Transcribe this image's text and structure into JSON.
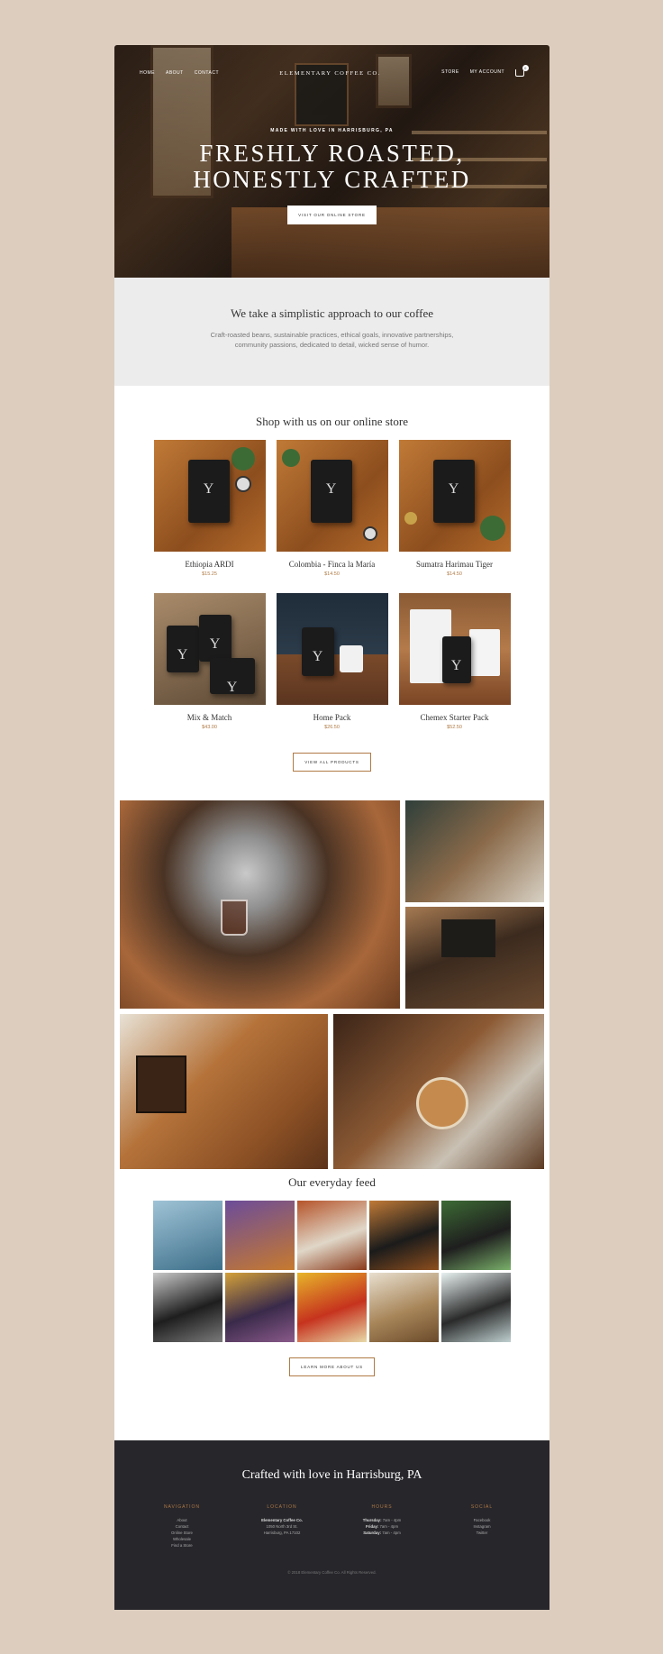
{
  "nav": {
    "left": [
      "Home",
      "About",
      "Contact"
    ],
    "brand": "Elementary Coffee Co.",
    "right": [
      "Store",
      "My Account"
    ],
    "cart_count": "0"
  },
  "hero": {
    "eyebrow": "MADE WITH LOVE IN HARRISBURG, PA",
    "title_line1": "FRESHLY ROASTED,",
    "title_line2": "HONESTLY CRAFTED",
    "button": "Visit our online store"
  },
  "approach": {
    "title": "We take a simplistic approach to our coffee",
    "line1": "Craft-roasted beans, sustainable practices, ethical goals, innovative partnerships,",
    "line2": "community passions, dedicated to detail, wicked sense of humor."
  },
  "shop": {
    "title": "Shop with us on our online store",
    "products": [
      {
        "name": "Ethiopia ARDI",
        "price": "$15.25"
      },
      {
        "name": "Colombia - Finca la María",
        "price": "$14.50"
      },
      {
        "name": "Sumatra Harimau Tiger",
        "price": "$14.50"
      },
      {
        "name": "Mix & Match",
        "price": "$43.00"
      },
      {
        "name": "Home Pack",
        "price": "$26.50"
      },
      {
        "name": "Chemex Starter Pack",
        "price": "$52.50"
      }
    ],
    "view_all": "View all products"
  },
  "feed": {
    "title": "Our everyday feed",
    "button": "Learn more about us"
  },
  "footer": {
    "title": "Crafted with love in Harrisburg, PA",
    "navigation": {
      "head": "Navigation",
      "items": [
        "About",
        "Contact",
        "Online Store",
        "Wholesale",
        "Find a Store"
      ]
    },
    "location": {
      "head": "Location",
      "name": "Elementary Coffee Co.",
      "address1": "1050 North 3rd St.",
      "address2": "Harrisburg, PA 17102"
    },
    "hours": {
      "head": "Hours",
      "rows": [
        {
          "day": "Thursday:",
          "time": "7am - 4pm"
        },
        {
          "day": "Friday:",
          "time": "7am - 4pm"
        },
        {
          "day": "Saturday:",
          "time": "7am - 4pm"
        }
      ]
    },
    "social": {
      "head": "Social",
      "items": [
        "Facebook",
        "Instagram",
        "Twitter"
      ]
    },
    "copyright": "© 2018 Elementary Coffee Co. All Rights Reserved."
  },
  "colors": {
    "background": "#dccdbf",
    "accent": "#b07a45",
    "footer": "#27262b",
    "band": "#ececec"
  }
}
